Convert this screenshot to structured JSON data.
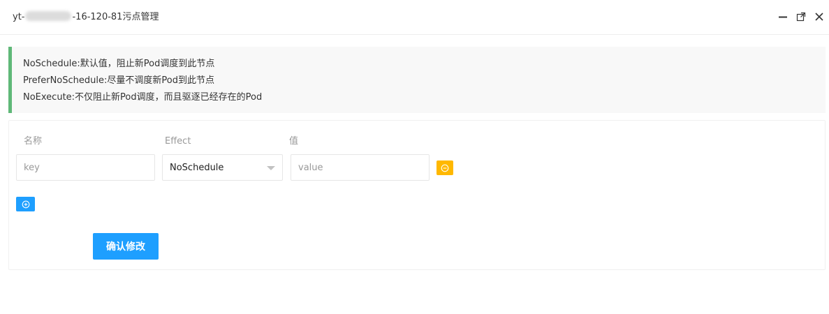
{
  "window": {
    "title_prefix": "yt-",
    "title_suffix": "-16-120-81污点管理",
    "minimize_icon": "minimize-icon",
    "maximize_icon": "maximize-icon",
    "close_icon": "close-icon"
  },
  "notice": {
    "lines": [
      "NoSchedule:默认值，阻止新Pod调度到此节点",
      "PreferNoSchedule:尽量不调度新Pod到此节点",
      "NoExecute:不仅阻止新Pod调度，而且驱逐已经存在的Pod"
    ],
    "accent_color": "#5fb878"
  },
  "form": {
    "labels": {
      "name": "名称",
      "effect": "Effect",
      "value": "值"
    },
    "row": {
      "key_placeholder": "key",
      "effect_selected": "NoSchedule",
      "value_placeholder": "value"
    },
    "remove_icon": "minus-circle-icon",
    "add_icon": "plus-circle-icon",
    "confirm_label": "确认修改"
  },
  "colors": {
    "primary": "#1e9fff",
    "warning": "#ffb800"
  }
}
